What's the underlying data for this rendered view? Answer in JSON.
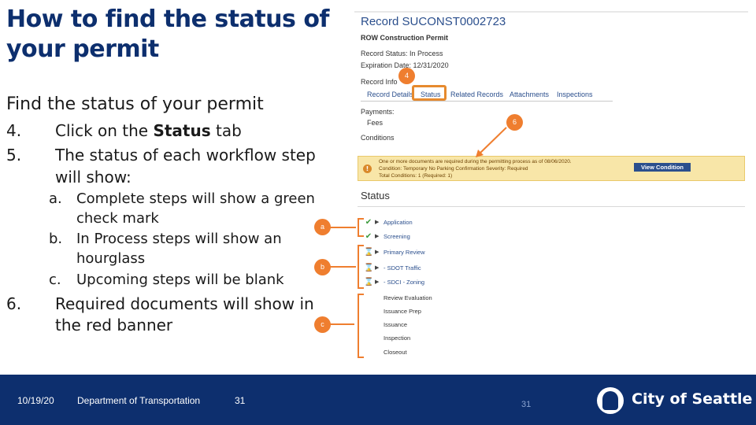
{
  "title": "How to find the status of your permit",
  "section_heading": "Find the status of your permit",
  "steps": [
    {
      "num": "4.",
      "text_before": "Click on the ",
      "text_bold": "Status",
      "text_after": " tab"
    },
    {
      "num": "5.",
      "text_line1": "The status of each workflow step",
      "text_line2": "will show:"
    }
  ],
  "substeps": [
    {
      "num": "a.",
      "line1": "Complete steps will show a green",
      "line2": "check mark"
    },
    {
      "num": "b.",
      "line1": "In Process steps will show an",
      "line2": "hourglass"
    },
    {
      "num": "c.",
      "line1": "Upcoming steps will be blank"
    }
  ],
  "step6": {
    "num": "6.",
    "line1": "Required documents will show in",
    "line2": "the red banner"
  },
  "screenshot": {
    "record_title": "Record SUCONST0002723",
    "permit_type": "ROW Construction Permit",
    "record_status": "Record Status: In Process",
    "expiration": "Expiration Date: 12/31/2020",
    "record_info": "Record Info",
    "tabs": [
      "Record Details",
      "Status",
      "Related Records",
      "Attachments",
      "Inspections"
    ],
    "payments_label": "Payments:",
    "fees_link": "Fees",
    "conditions_label": "Conditions",
    "banner": {
      "line1": "One or more documents are required during the permitting process as of 08/06/2020.",
      "line2": "Condition: Temporary No Parking Confirmation   Severity: Required",
      "line3": "Total Conditions: 1 (Required: 1)",
      "button": "View Condition"
    },
    "status_heading": "Status",
    "workflow": [
      {
        "label": "Application",
        "state": "complete"
      },
      {
        "label": "Screening",
        "state": "complete"
      },
      {
        "label": "Primary Review",
        "state": "in-process"
      },
      {
        "label": "- SDOT Traffic",
        "state": "in-process"
      },
      {
        "label": "- SDCI - Zoning",
        "state": "in-process"
      },
      {
        "label": "Review Evaluation",
        "state": "upcoming"
      },
      {
        "label": "Issuance Prep",
        "state": "upcoming"
      },
      {
        "label": "Issuance",
        "state": "upcoming"
      },
      {
        "label": "Inspection",
        "state": "upcoming"
      },
      {
        "label": "Closeout",
        "state": "upcoming"
      }
    ]
  },
  "badges": {
    "b4": "4",
    "b6": "6",
    "ba": "a",
    "bb": "b",
    "bc": "c"
  },
  "footer": {
    "date": "10/19/20",
    "department": "Department of Transportation",
    "page": "31",
    "page_center": "31",
    "logo_text": "City of Seattle"
  },
  "colors": {
    "title": "#0d2f6e",
    "footer": "#0d2f6e",
    "badge": "#ef7e2f",
    "check": "#3d9a3d",
    "link": "#2b4f8d"
  },
  "icons": {
    "complete": "check-icon",
    "in-process": "hourglass-icon",
    "caret": "caret-right-icon",
    "warning": "warning-icon"
  }
}
